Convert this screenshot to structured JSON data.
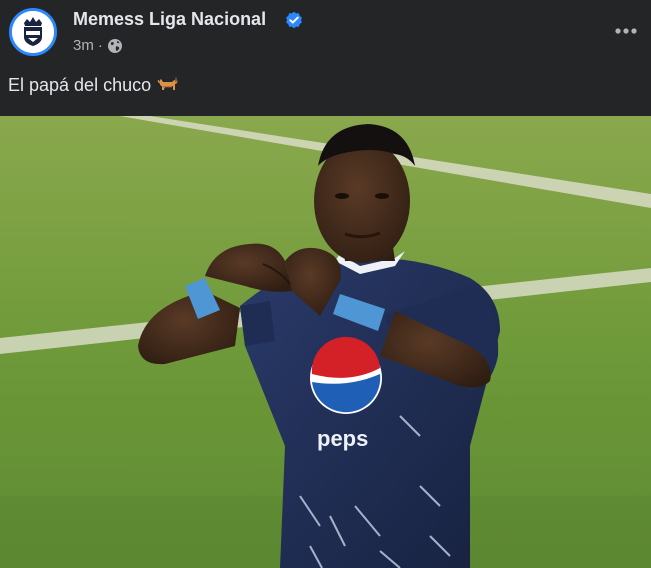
{
  "post": {
    "page_name": "Memess Liga Nacional",
    "time": "3m",
    "separator": "·",
    "audience_icon": "globe-icon",
    "verified_icon": "verified-badge-icon",
    "more_icon": "more-options-icon",
    "caption": "El papá del chuco",
    "caption_emoji": "dog-icon",
    "photo": {
      "alt_subject": "football-player-heart-gesture",
      "jersey_sponsor": "peps"
    }
  },
  "colors": {
    "background": "#242526",
    "text_primary": "#e4e6eb",
    "text_secondary": "#b0b3b8",
    "accent": "#2d88ff",
    "grass": "#6f9a3a",
    "jersey": "#1f2d55"
  }
}
